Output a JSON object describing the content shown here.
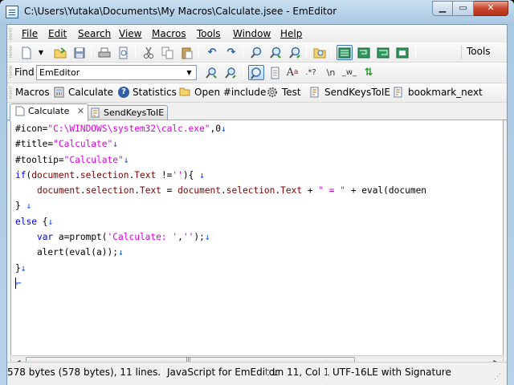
{
  "window": {
    "title": "C:\\Users\\Yutaka\\Documents\\My Macros\\Calculate.jsee - EmEditor"
  },
  "menu": [
    "File",
    "Edit",
    "Search",
    "View",
    "Macros",
    "Tools",
    "Window",
    "Help"
  ],
  "toolbar": {
    "tools_label": "Tools"
  },
  "find": {
    "label": "Find",
    "value": "EmEditor"
  },
  "macros_bar": {
    "label": "Macros",
    "items": [
      "Calculate",
      "Statistics",
      "Open #include",
      "Test",
      "SendKeysToIE",
      "bookmark_next"
    ]
  },
  "tabs": [
    {
      "label": "Calculate",
      "close": "✕"
    },
    {
      "label": "SendKeysToIE"
    }
  ],
  "editor": {
    "lines": [
      "#icon=\"C:\\WINDOWS\\system32\\calc.exe\",0↓",
      "#title=\"Calculate\"↓",
      "#tooltip=\"Calculate\"↓",
      "if(document.selection.Text !=''){ ↓",
      "    document.selection.Text = document.selection.Text + \" = \" + eval(documen",
      "} ↓",
      "else {↓",
      "    var a=prompt('Calculate: ','');↓",
      "    alert(eval(a));↓",
      "}↓",
      "⌐"
    ]
  },
  "status": {
    "size": "578 bytes (578 bytes), 11 lines.",
    "mode": "JavaScript for EmEditor",
    "position": "Ln 11, Col 1",
    "encoding": "UTF-16LE with Signature"
  }
}
